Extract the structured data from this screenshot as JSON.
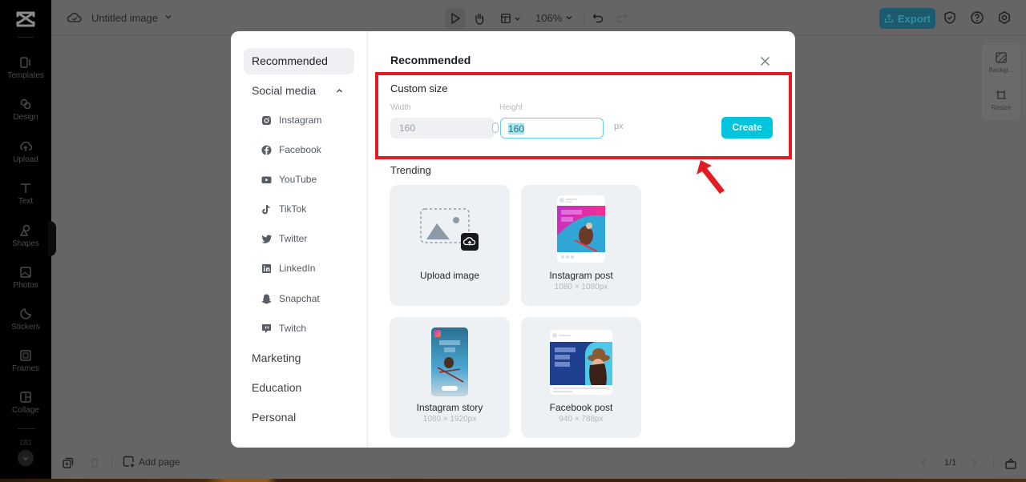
{
  "app": {
    "document_title": "Untitled image",
    "zoom_level": "106%"
  },
  "rail": {
    "items": [
      {
        "label": "Templates",
        "icon": "templates-icon"
      },
      {
        "label": "Design",
        "icon": "design-icon"
      },
      {
        "label": "Upload",
        "icon": "upload-icon"
      },
      {
        "label": "Text",
        "icon": "text-icon"
      },
      {
        "label": "Shapes",
        "icon": "shapes-icon"
      },
      {
        "label": "Photos",
        "icon": "photos-icon"
      },
      {
        "label": "Stickers",
        "icon": "stickers-icon"
      },
      {
        "label": "Frames",
        "icon": "frames-icon"
      },
      {
        "label": "Collage",
        "icon": "collage-icon"
      }
    ]
  },
  "toolbar": {
    "export_label": "Export"
  },
  "right_panel": {
    "background_label": "Backgr...",
    "resize_label": "Resize"
  },
  "bottombar": {
    "add_page_label": "Add page",
    "page_indicator": "1/1"
  },
  "modal": {
    "categories": {
      "recommended": "Recommended",
      "social_media": "Social media",
      "marketing": "Marketing",
      "education": "Education",
      "personal": "Personal"
    },
    "social_items": [
      {
        "label": "Instagram",
        "icon": "instagram-icon"
      },
      {
        "label": "Facebook",
        "icon": "facebook-icon"
      },
      {
        "label": "YouTube",
        "icon": "youtube-icon"
      },
      {
        "label": "TikTok",
        "icon": "tiktok-icon"
      },
      {
        "label": "Twitter",
        "icon": "twitter-icon"
      },
      {
        "label": "LinkedIn",
        "icon": "linkedin-icon"
      },
      {
        "label": "Snapchat",
        "icon": "snapchat-icon"
      },
      {
        "label": "Twitch",
        "icon": "twitch-icon"
      }
    ],
    "title": "Recommended",
    "custom_size": {
      "title": "Custom size",
      "width_label": "Width",
      "height_label": "Height",
      "width_value": "160",
      "height_value": "160",
      "unit": "px",
      "create_label": "Create"
    },
    "trending": {
      "title": "Trending",
      "cards": [
        {
          "name": "Upload image",
          "dims": ""
        },
        {
          "name": "Instagram post",
          "dims": "1080 × 1080px"
        },
        {
          "name": "Instagram story",
          "dims": "1080 × 1920px"
        },
        {
          "name": "Facebook post",
          "dims": "940 × 788px"
        }
      ]
    }
  },
  "colors": {
    "accent": "#00c5dc",
    "annotation": "#e31b23"
  }
}
